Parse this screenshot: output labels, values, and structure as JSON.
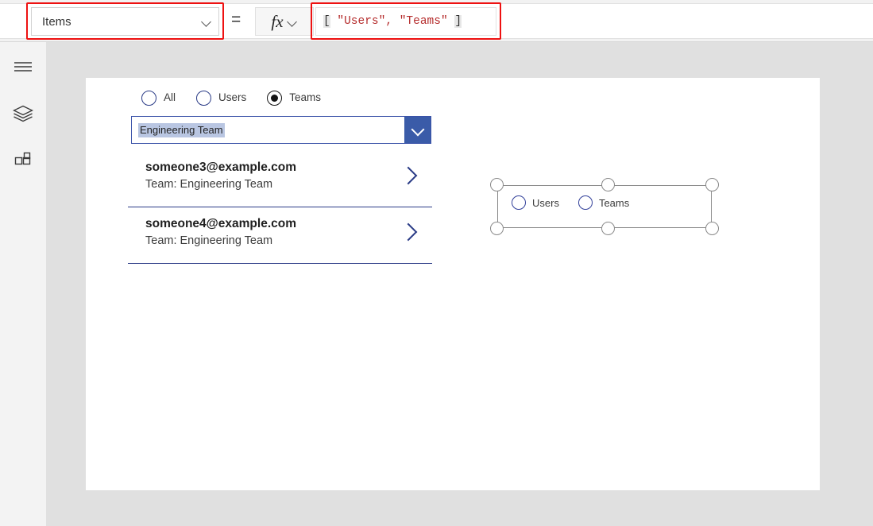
{
  "formula_bar": {
    "property_label": "Items",
    "property_chevron_icon": "chevron-down-icon",
    "equals": "=",
    "fx_glyph": "fx",
    "fx_chevron_icon": "chevron-down-icon",
    "formula_tokens": {
      "open_bracket": "[",
      "space_1": " ",
      "string_1": "\"Users\"",
      "comma": ",",
      "space_2": " ",
      "string_2": "\"Teams\"",
      "space_3": " ",
      "close_bracket": "]"
    },
    "formula_full_text": "[ \"Users\", \"Teams\" ]",
    "highlight_color": "#ee1111",
    "string_color": "#b52c2c"
  },
  "left_rail": {
    "items": [
      {
        "name": "menu",
        "icon": "hamburger-menu-icon"
      },
      {
        "name": "tree-view",
        "icon": "layers-icon"
      },
      {
        "name": "insert",
        "icon": "grid-insert-icon"
      }
    ]
  },
  "canvas": {
    "radio_group": {
      "options": [
        {
          "label": "All",
          "selected": false
        },
        {
          "label": "Users",
          "selected": false
        },
        {
          "label": "Teams",
          "selected": true
        }
      ]
    },
    "dropdown": {
      "value": "Engineering Team",
      "chevron_icon": "chevron-down-icon",
      "accent_color": "#3a5ba8",
      "selection_highlight_color": "#b9c6e2"
    },
    "gallery": {
      "items": [
        {
          "title": "someone3@example.com",
          "subtitle": "Team: Engineering Team",
          "chevron_icon": "chevron-right-icon"
        },
        {
          "title": "someone4@example.com",
          "subtitle": "Team: Engineering Team",
          "chevron_icon": "chevron-right-icon"
        }
      ],
      "separator_color": "#2a3b86"
    },
    "selected_control": {
      "type": "radio-group",
      "options": [
        {
          "label": "Users",
          "selected": false
        },
        {
          "label": "Teams",
          "selected": false
        }
      ],
      "handles": [
        "top-left",
        "top-middle",
        "top-right",
        "bottom-left",
        "bottom-middle",
        "bottom-right"
      ]
    }
  }
}
